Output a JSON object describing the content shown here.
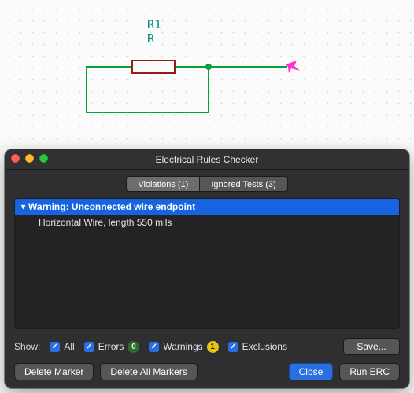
{
  "schematic": {
    "ref": "R1",
    "value": "R"
  },
  "dialog": {
    "title": "Electrical Rules Checker",
    "tabs": {
      "violations": "Violations (1)",
      "ignored": "Ignored Tests (3)"
    },
    "violation": {
      "header": "Warning: Unconnected wire endpoint",
      "detail": "Horizontal Wire, length 550 mils"
    },
    "filters": {
      "show_label": "Show:",
      "all": "All",
      "errors": "Errors",
      "errors_count": "0",
      "warnings": "Warnings",
      "warnings_count": "1",
      "exclusions": "Exclusions"
    },
    "buttons": {
      "save": "Save...",
      "delete_marker": "Delete Marker",
      "delete_all": "Delete All Markers",
      "close": "Close",
      "run": "Run ERC"
    }
  }
}
